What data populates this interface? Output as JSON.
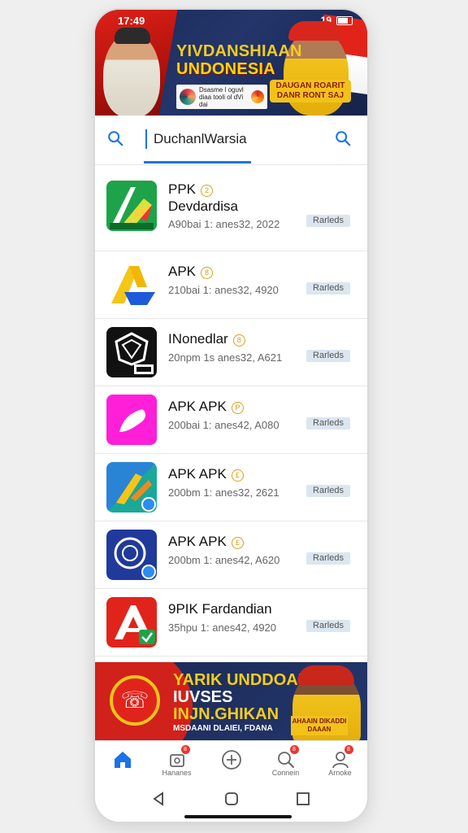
{
  "status_bar": {
    "time": "17:49",
    "signal": "19"
  },
  "top_banner": {
    "title_line1": "YIVDANSHIAAN",
    "title_line2": "UNDONESIA",
    "info_text": "Dsasme l oguvl diaa tooli ol dVi dai",
    "badge_text": "DAUGAN ROARIT DANR RONT SAJ",
    "colors": {
      "background": "#1b2a57",
      "accent": "#f5cc1d",
      "red": "#e2231a"
    }
  },
  "search": {
    "query": "DuchanlWarsia",
    "left_icon": "search-icon",
    "right_icon": "search-icon",
    "accent": "#1a73e8"
  },
  "apps": [
    {
      "name": "PPK",
      "subtitle": "Devdardisa",
      "meta": "A90bai 1: anes32, 2022",
      "tag": "Rarleds",
      "coin": "2",
      "icon": "green-triangle-icon"
    },
    {
      "name": "APK",
      "subtitle": "",
      "meta": "210bai 1: anes32, 4920",
      "tag": "Rarleds",
      "coin": "8",
      "icon": "yellow-a-icon"
    },
    {
      "name": "INonedlar",
      "subtitle": "",
      "meta": "20npm 1s anes32, A621",
      "tag": "Rarleds",
      "coin": "8",
      "icon": "black-shield-icon"
    },
    {
      "name": "APK APK",
      "subtitle": "",
      "meta": "200bai 1: anes42, A080",
      "tag": "Rarleds",
      "coin": "P",
      "icon": "magenta-app-icon"
    },
    {
      "name": "APK APK",
      "subtitle": "",
      "meta": "200bm 1: anes32, 2621",
      "tag": "Rarleds",
      "coin": "£",
      "icon": "teal-arrow-icon"
    },
    {
      "name": "APK APK",
      "subtitle": "",
      "meta": "200bm 1: anes42, A620",
      "tag": "Rarleds",
      "coin": "£",
      "icon": "navy-seal-icon"
    },
    {
      "name": "9PIK Fardandian",
      "subtitle": "",
      "meta": "35hpu 1: anes42, 4920",
      "tag": "Rarleds",
      "coin": "",
      "icon": "red-a-icon"
    }
  ],
  "bottom_banner": {
    "line1": "YARIK UNDDOAN",
    "line2": "IUVSES",
    "line3": "INJN.GHIKAN",
    "sub": "MSDAANI  DLAIEI, FDANA",
    "badge": "AHAAIN DIKADDI DAAAN"
  },
  "bottom_nav": [
    {
      "label": "",
      "icon": "home-icon",
      "active": true,
      "badge": ""
    },
    {
      "label": "Hananes",
      "icon": "box-icon",
      "active": false,
      "badge": "8"
    },
    {
      "label": "",
      "icon": "plus-circle-icon",
      "active": false,
      "badge": ""
    },
    {
      "label": "Connein",
      "icon": "search-icon",
      "active": false,
      "badge": "8"
    },
    {
      "label": "Arnoke",
      "icon": "user-icon",
      "active": false,
      "badge": "8"
    }
  ]
}
